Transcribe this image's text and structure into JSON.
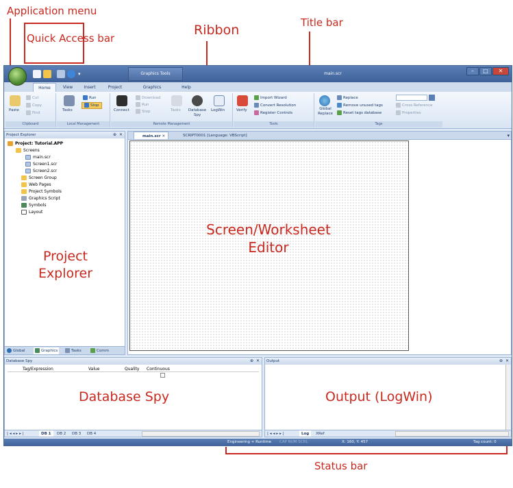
{
  "annotations": {
    "application_menu": "Application menu",
    "quick_access_bar": "Quick Access bar",
    "ribbon": "Ribbon",
    "title_bar": "Title bar",
    "screen_editor_line1": "Screen/Worksheet",
    "screen_editor_line2": "Editor",
    "project_explorer_line1": "Project",
    "project_explorer_line2": "Explorer",
    "database_spy": "Database Spy",
    "output_logwin": "Output (LogWin)",
    "status_bar": "Status bar"
  },
  "titlebar": {
    "contextual_tab": "Graphics Tools",
    "title": "main.scr"
  },
  "ribbon_tabs": [
    "Home",
    "View",
    "Insert",
    "Project",
    "Graphics",
    "Help"
  ],
  "ribbon": {
    "clipboard": {
      "paste": "Paste",
      "cut": "Cut",
      "copy": "Copy",
      "find": "Find",
      "label": "Clipboard"
    },
    "local_management": {
      "tasks": "Tasks",
      "run": "Run",
      "stop": "Stop",
      "label": "Local Management"
    },
    "remote_management": {
      "connect": "Connect",
      "download": "Download",
      "run": "Run",
      "stop": "Stop",
      "tasks": "Tasks",
      "database_spy_1": "Database",
      "database_spy_2": "Spy",
      "logwin": "LogWin",
      "label": "Remote Management"
    },
    "tools": {
      "verify": "Verify",
      "import_wizard": "Import Wizard",
      "convert_resolution": "Convert Resolution",
      "register_controls": "Register Controls",
      "label": "Tools"
    },
    "tags": {
      "global_replace_1": "Global",
      "global_replace_2": "Replace",
      "replace": "Replace",
      "remove_unused": "Remove unused tags",
      "reset_db": "Reset tags database",
      "cross_reference": "Cross Reference",
      "properties": "Properties",
      "label": "Tags"
    }
  },
  "project_explorer": {
    "header": "Project Explorer",
    "items": [
      {
        "label": "Project: Tutorial.APP"
      },
      {
        "label": "Screens"
      },
      {
        "label": "main.scr"
      },
      {
        "label": "Screen1.scr"
      },
      {
        "label": "Screen2.scr"
      },
      {
        "label": "Screen Group"
      },
      {
        "label": "Web Pages"
      },
      {
        "label": "Project Symbols"
      },
      {
        "label": "Graphics Script"
      },
      {
        "label": "Symbols"
      },
      {
        "label": "Layout"
      }
    ],
    "bottom_tabs": [
      "Global",
      "Graphics",
      "Tasks",
      "Comm"
    ]
  },
  "editor": {
    "tabs": [
      "main.scr",
      "SCRIPT0001 [Language: VBScript]"
    ]
  },
  "database_spy": {
    "header": "Database Spy",
    "columns": [
      "Tag/Expression",
      "Value",
      "Quality",
      "Continuous"
    ],
    "sheets": [
      "DB 1",
      "DB 2",
      "DB 3",
      "DB 4"
    ]
  },
  "output": {
    "header": "Output",
    "tabs": [
      "Log",
      "XRef"
    ]
  },
  "status_bar": {
    "mode": "Engineering + Runtime",
    "keys": "CAP NUM SCRL",
    "coords": "X: 160, Y: 457",
    "tag_count": "Tag count: 0"
  },
  "colors": {
    "annotation": "#c8281e",
    "titlebar": "#3d6198",
    "ribbon_bg": "#dfe8f5"
  }
}
